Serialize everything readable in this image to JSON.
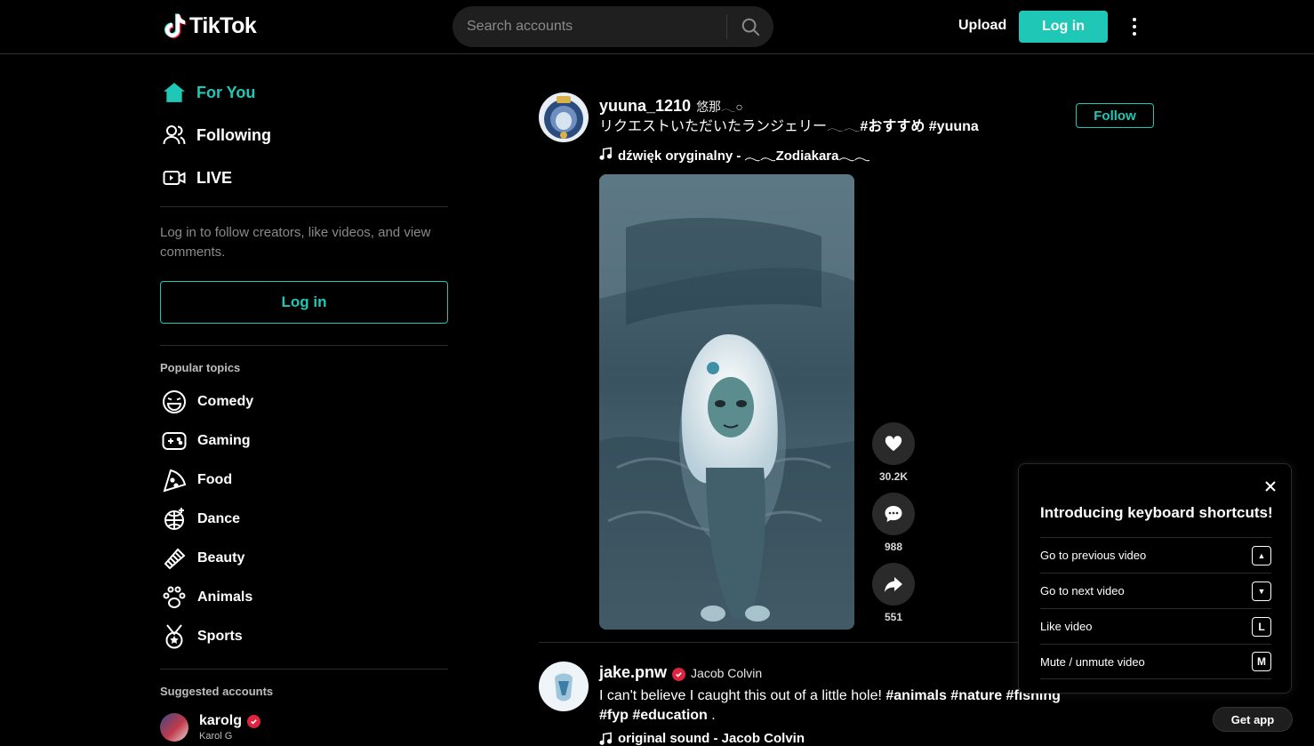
{
  "header": {
    "brand": "TikTok",
    "search_placeholder": "Search accounts",
    "upload_label": "Upload",
    "login_label": "Log in"
  },
  "sidebar": {
    "nav": [
      {
        "label": "For You",
        "icon": "home-icon",
        "active": true
      },
      {
        "label": "Following",
        "icon": "people-icon",
        "active": false
      },
      {
        "label": "LIVE",
        "icon": "live-icon",
        "active": false
      }
    ],
    "login_note": "Log in to follow creators, like videos, and view comments.",
    "login_label": "Log in",
    "popular_title": "Popular topics",
    "topics": [
      {
        "label": "Comedy",
        "icon": "comedy-icon"
      },
      {
        "label": "Gaming",
        "icon": "gaming-icon"
      },
      {
        "label": "Food",
        "icon": "food-icon"
      },
      {
        "label": "Dance",
        "icon": "dance-icon"
      },
      {
        "label": "Beauty",
        "icon": "beauty-icon"
      },
      {
        "label": "Animals",
        "icon": "animals-icon"
      },
      {
        "label": "Sports",
        "icon": "sports-icon"
      }
    ],
    "suggested_title": "Suggested accounts",
    "suggested": [
      {
        "name": "karolg",
        "sub": "Karol G",
        "verified": true
      }
    ]
  },
  "posts": [
    {
      "author": "yuuna_1210",
      "nickname": "悠那𓂃○",
      "caption_text": "リクエストいただいたランジェリー𓂃𓂃",
      "caption_tags": "#おすすめ #yuuna",
      "music": "dźwięk oryginalny - 𓂃𓂃Zodiakara𓂃𓂃",
      "follow_label": "Follow",
      "likes": "30.2K",
      "comments": "988",
      "shares": "551"
    },
    {
      "author": "jake.pnw",
      "nickname": "Jacob Colvin",
      "verified": true,
      "caption_text": "I can't believe I caught this out of a little hole!",
      "caption_tags_1": "#animals #nature #fishing",
      "caption_tags_2": "#fyp #education",
      "caption_end": ".",
      "music": "original sound - Jacob Colvin"
    }
  ],
  "shortcuts": {
    "title": "Introducing keyboard shortcuts!",
    "items": [
      {
        "label": "Go to previous video",
        "key": "▲"
      },
      {
        "label": "Go to next video",
        "key": "▼"
      },
      {
        "label": "Like video",
        "key": "L"
      },
      {
        "label": "Mute / unmute video",
        "key": "M"
      }
    ]
  },
  "get_app_label": "Get app",
  "colors": {
    "accent": "#1fc8b6",
    "verified": "#e0243f",
    "background": "#000000"
  }
}
